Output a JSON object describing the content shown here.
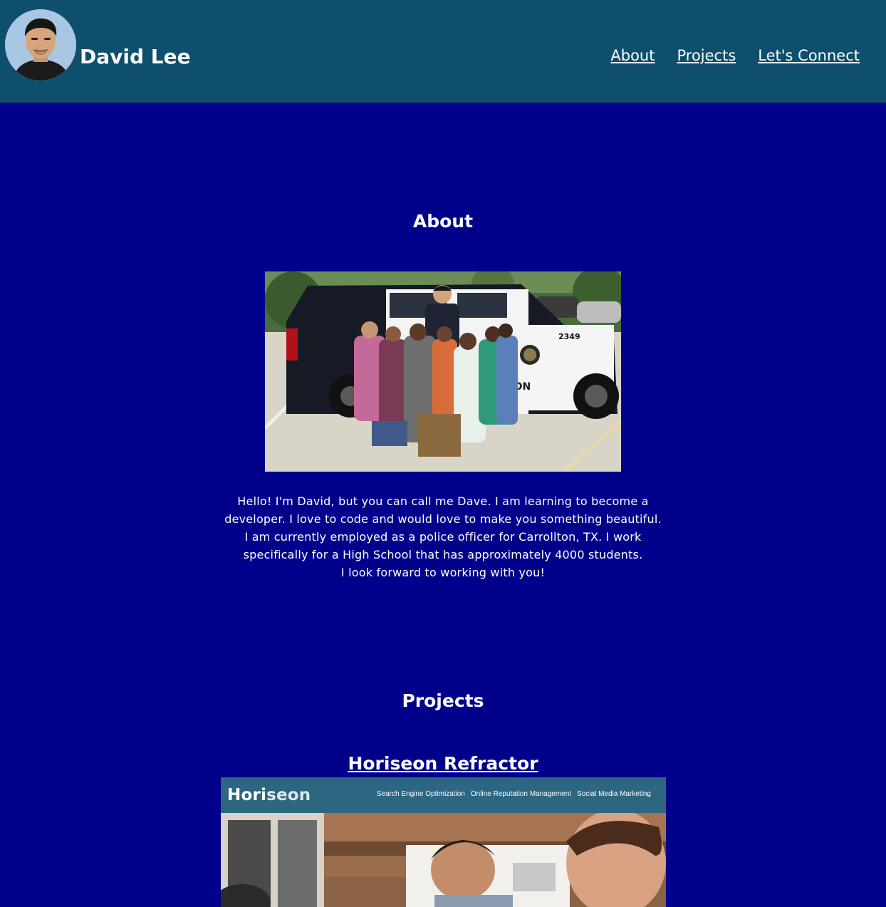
{
  "header": {
    "name": "David Lee",
    "nav": [
      "About",
      "Projects",
      "Let's Connect"
    ]
  },
  "about": {
    "title": "About",
    "paragraphs": [
      "Hello! I'm David, but you can call me Dave. I am learning to become a developer. I love to code and would love to make you something beautiful.",
      "I am currently employed as a police officer for Carrollton, TX. I work specifically for a High School that has approximately 4000 students.",
      "I look forward to working with you!"
    ],
    "photo_text": {
      "unit_number": "2349",
      "door_text": "TON"
    }
  },
  "projects": {
    "title": "Projects",
    "items": [
      {
        "title": "Horiseon Refractor",
        "screenshot": {
          "logo_start": "Hori",
          "logo_end": "seon",
          "nav": [
            "Search Engine Optimization",
            "Online Reputation Management",
            "Social Media Marketing"
          ]
        }
      }
    ]
  },
  "colors": {
    "page_background": "#00008b",
    "header_background": "#0d4f6c",
    "text": "#ffffff"
  }
}
